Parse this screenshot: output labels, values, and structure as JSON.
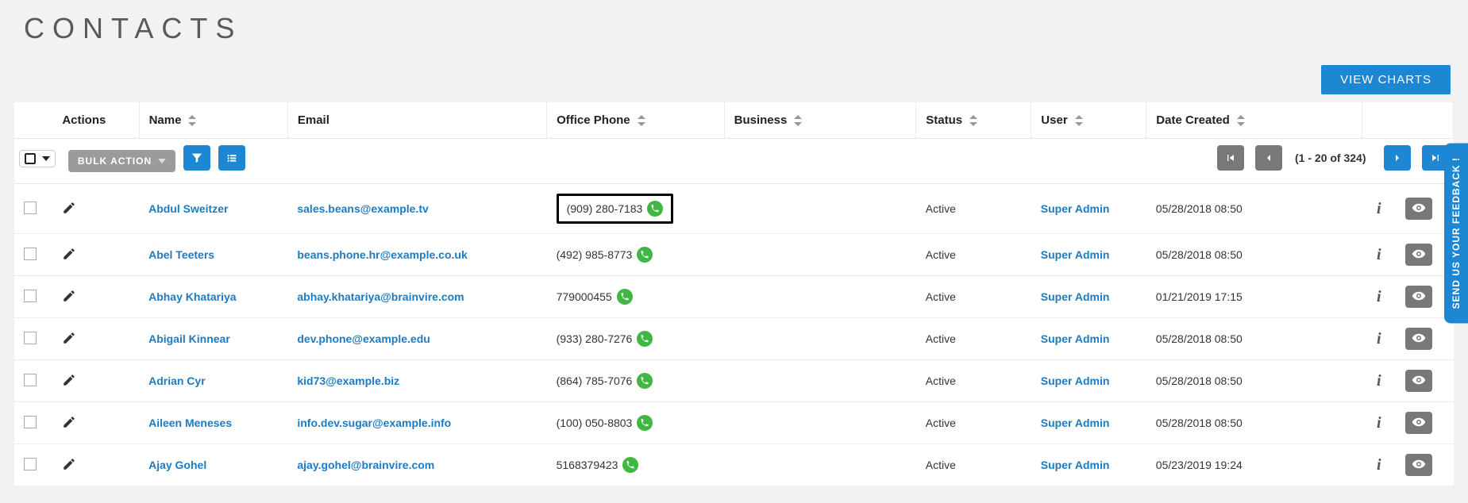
{
  "page_title": "CONTACTS",
  "buttons": {
    "view_charts": "VIEW CHARTS",
    "bulk_action": "BULK ACTION"
  },
  "pager": {
    "text": "(1 - 20 of 324)"
  },
  "columns": {
    "actions": "Actions",
    "name": "Name",
    "email": "Email",
    "office_phone": "Office Phone",
    "business": "Business",
    "status": "Status",
    "user": "User",
    "date_created": "Date Created"
  },
  "rows": [
    {
      "name": "Abdul Sweitzer",
      "email": "sales.beans@example.tv",
      "phone": "(909) 280-7183",
      "status": "Active",
      "user": "Super Admin",
      "date": "05/28/2018 08:50",
      "highlight": true
    },
    {
      "name": "Abel Teeters",
      "email": "beans.phone.hr@example.co.uk",
      "phone": "(492) 985-8773",
      "status": "Active",
      "user": "Super Admin",
      "date": "05/28/2018 08:50",
      "highlight": false
    },
    {
      "name": "Abhay Khatariya",
      "email": "abhay.khatariya@brainvire.com",
      "phone": "779000455",
      "status": "Active",
      "user": "Super Admin",
      "date": "01/21/2019 17:15",
      "highlight": false
    },
    {
      "name": "Abigail Kinnear",
      "email": "dev.phone@example.edu",
      "phone": "(933) 280-7276",
      "status": "Active",
      "user": "Super Admin",
      "date": "05/28/2018 08:50",
      "highlight": false
    },
    {
      "name": "Adrian Cyr",
      "email": "kid73@example.biz",
      "phone": "(864) 785-7076",
      "status": "Active",
      "user": "Super Admin",
      "date": "05/28/2018 08:50",
      "highlight": false
    },
    {
      "name": "Aileen Meneses",
      "email": "info.dev.sugar@example.info",
      "phone": "(100) 050-8803",
      "status": "Active",
      "user": "Super Admin",
      "date": "05/28/2018 08:50",
      "highlight": false
    },
    {
      "name": "Ajay Gohel",
      "email": "ajay.gohel@brainvire.com",
      "phone": "5168379423",
      "status": "Active",
      "user": "Super Admin",
      "date": "05/23/2019 19:24",
      "highlight": false
    }
  ],
  "feedback_tab": "SEND US YOUR FEEDBACK !"
}
